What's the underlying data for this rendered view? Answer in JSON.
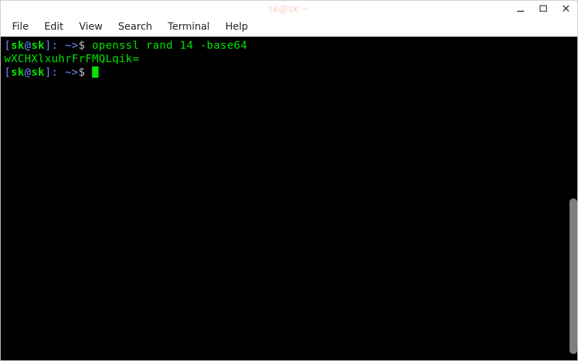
{
  "titlebar": {
    "title": "sk@sk:~"
  },
  "menubar": {
    "items": [
      {
        "label": "File"
      },
      {
        "label": "Edit"
      },
      {
        "label": "View"
      },
      {
        "label": "Search"
      },
      {
        "label": "Terminal"
      },
      {
        "label": "Help"
      }
    ]
  },
  "terminal": {
    "line1_prompt_lbracket": "[",
    "line1_prompt_user": "sk",
    "line1_prompt_at": "@",
    "line1_prompt_host": "sk",
    "line1_prompt_rbracket": "]",
    "line1_prompt_path": ": ~>",
    "line1_prompt_dollar": "$ ",
    "line1_command": "openssl rand 14 -base64",
    "line2_output": "wXCHXlxuhrFrFMQLqik=",
    "line3_prompt_lbracket": "[",
    "line3_prompt_user": "sk",
    "line3_prompt_at": "@",
    "line3_prompt_host": "sk",
    "line3_prompt_rbracket": "]",
    "line3_prompt_path": ": ~>",
    "line3_prompt_dollar": "$ "
  },
  "scrollbar": {
    "thumb_top_pct": 50,
    "thumb_height_pct": 48
  }
}
